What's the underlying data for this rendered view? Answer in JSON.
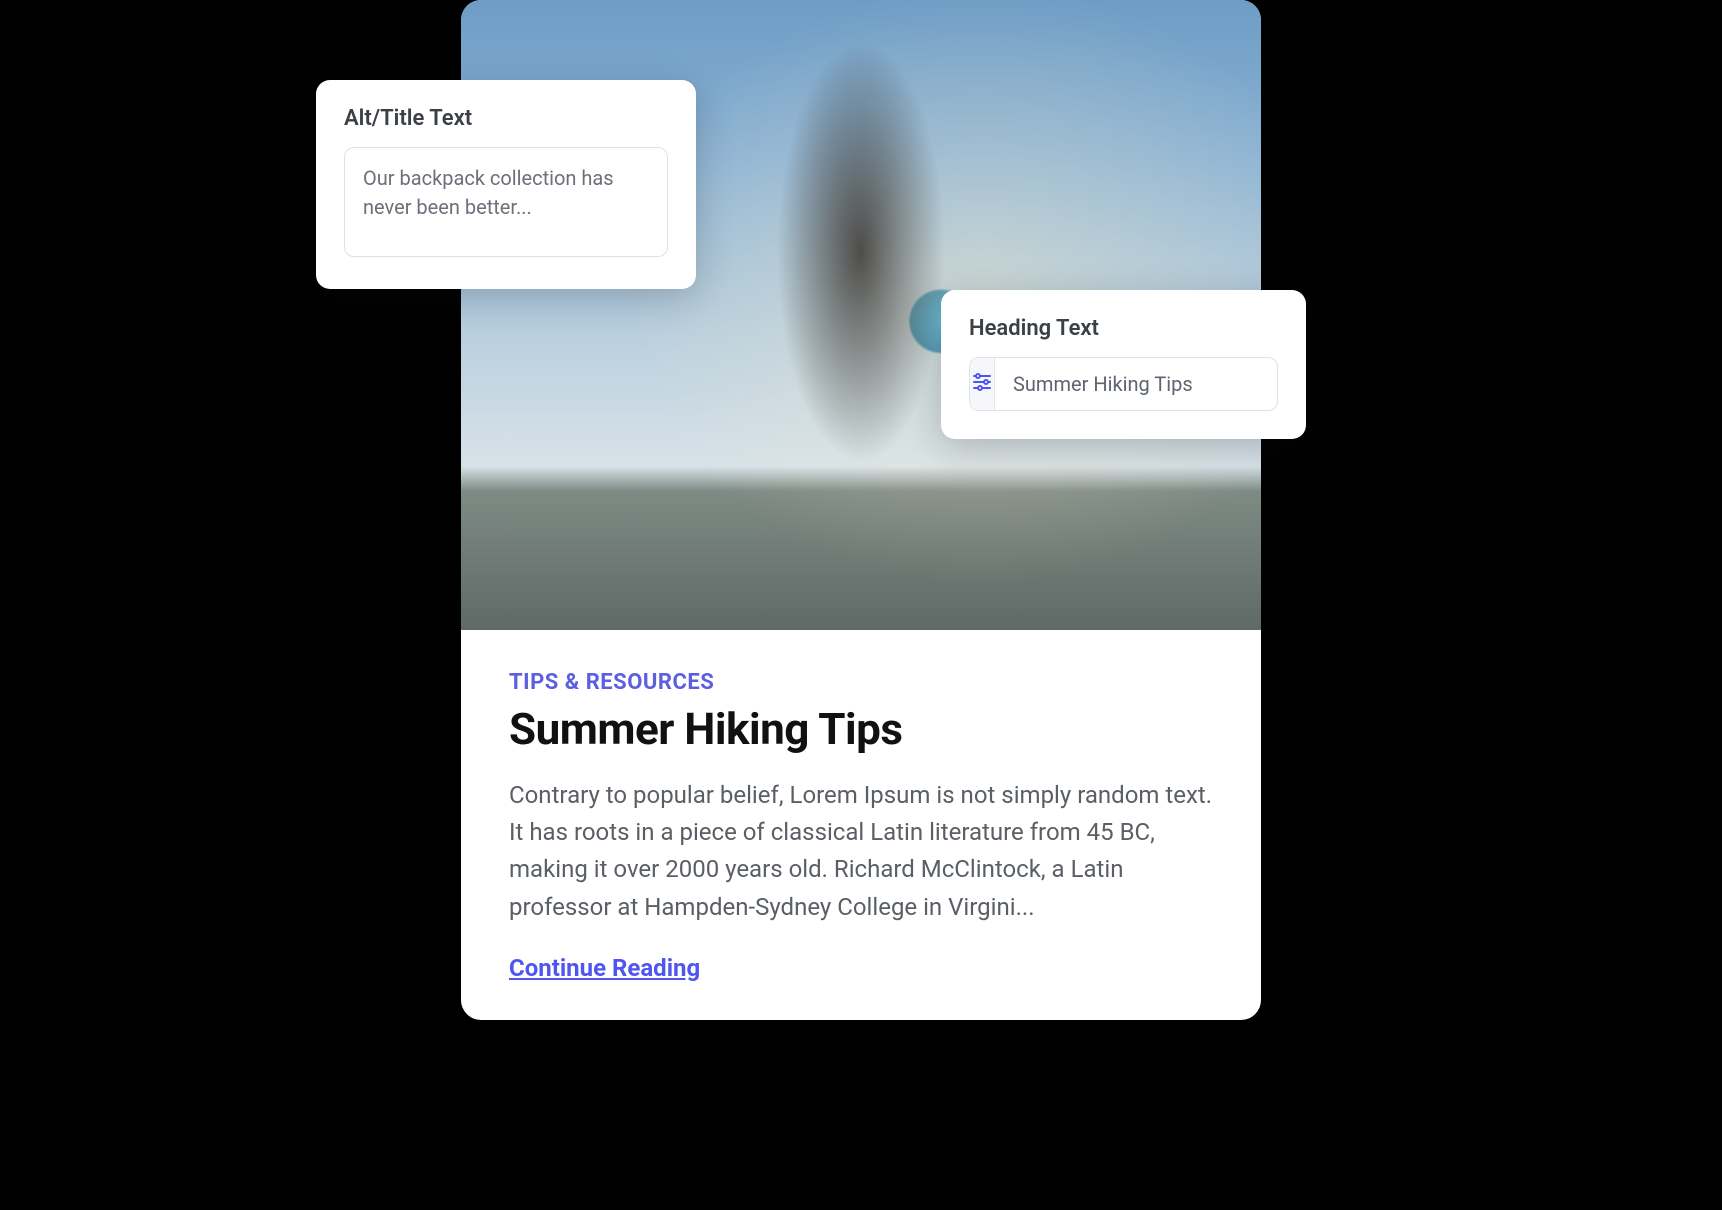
{
  "card": {
    "eyebrow": "TIPS & RESOURCES",
    "headline": "Summer Hiking Tips",
    "excerpt": "Contrary to popular belief, Lorem Ipsum is not simply random text. It has roots in a piece of classical Latin literature from 45 BC, making it over 2000 years old. Richard McClintock, a Latin professor at Hampden-Sydney College in Virgini...",
    "continue_label": "Continue Reading"
  },
  "alt_popover": {
    "label": "Alt/Title Text",
    "value": "Our backpack collection has never been better..."
  },
  "heading_popover": {
    "label": "Heading Text",
    "value": "Summer Hiking Tips"
  }
}
